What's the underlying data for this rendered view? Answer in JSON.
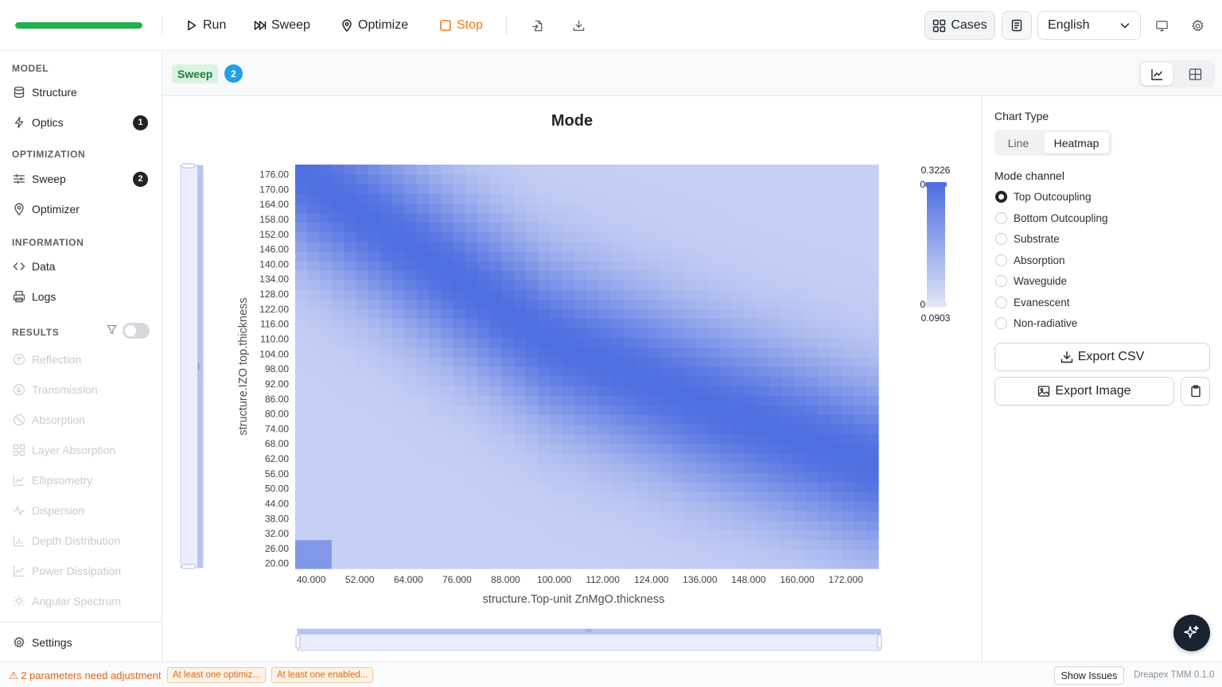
{
  "toolbar": {
    "progress": 1.0,
    "run_label": "Run",
    "sweep_label": "Sweep",
    "optimize_label": "Optimize",
    "stop_label": "Stop",
    "cases_label": "Cases",
    "language": "English"
  },
  "sidebar": {
    "model_title": "MODEL",
    "model_items": [
      {
        "label": "Structure",
        "icon": "database-icon"
      },
      {
        "label": "Optics",
        "icon": "lightning-icon",
        "badge": "1"
      }
    ],
    "optimization_title": "OPTIMIZATION",
    "optimization_items": [
      {
        "label": "Sweep",
        "icon": "sliders-icon",
        "badge": "2"
      },
      {
        "label": "Optimizer",
        "icon": "location-pin-icon"
      }
    ],
    "information_title": "INFORMATION",
    "information_items": [
      {
        "label": "Data",
        "icon": "code-icon"
      },
      {
        "label": "Logs",
        "icon": "printer-icon"
      }
    ],
    "results_title": "RESULTS",
    "results_items": [
      {
        "label": "Reflection"
      },
      {
        "label": "Transmission"
      },
      {
        "label": "Absorption"
      },
      {
        "label": "Layer Absorption"
      },
      {
        "label": "Ellipsometry"
      },
      {
        "label": "Dispersion"
      },
      {
        "label": "Depth Distribution"
      },
      {
        "label": "Power Dissipation"
      },
      {
        "label": "Angular Spectrum"
      }
    ],
    "settings_label": "Settings"
  },
  "subbar": {
    "tag": "Sweep",
    "count": "2"
  },
  "right_panel": {
    "chart_type_label": "Chart Type",
    "chart_types": [
      "Line",
      "Heatmap"
    ],
    "selected_chart_type": "Heatmap",
    "mode_channel_label": "Mode channel",
    "channels": [
      "Top Outcoupling",
      "Bottom Outcoupling",
      "Substrate",
      "Absorption",
      "Waveguide",
      "Evanescent",
      "Non-radiative"
    ],
    "selected_channel": "Top Outcoupling",
    "export_csv_label": "Export CSV",
    "export_image_label": "Export Image"
  },
  "status": {
    "warning": "2 parameters need adjustment",
    "chip1": "At least one optimiz...",
    "chip2": "At least one enabled...",
    "show_issues": "Show Issues",
    "version": "Dreapex TMM 0.1.0"
  },
  "chart_data": {
    "type": "heatmap",
    "title": "Mode",
    "xlabel": "structure.Top-unit ZnMgO.thickness",
    "ylabel": "structure.IZO top.thickness",
    "x_ticks": [
      "40.000",
      "52.000",
      "64.000",
      "76.000",
      "88.000",
      "100.000",
      "112.000",
      "124.000",
      "136.000",
      "148.000",
      "160.000",
      "172.000"
    ],
    "y_ticks": [
      "20.00",
      "26.00",
      "32.00",
      "38.00",
      "44.00",
      "50.00",
      "56.00",
      "62.00",
      "68.00",
      "74.00",
      "80.00",
      "86.00",
      "92.00",
      "98.00",
      "104.00",
      "110.00",
      "116.00",
      "122.00",
      "128.00",
      "134.00",
      "140.00",
      "146.00",
      "152.00",
      "158.00",
      "164.00",
      "170.00",
      "176.00"
    ],
    "x_range": [
      38,
      182
    ],
    "y_range": [
      18,
      180
    ],
    "value_range": [
      0.0903,
      0.3226
    ],
    "colorbar_max_label": "0.3226",
    "colorbar_min_label": "0.0903",
    "colorbar_top_handle": "0",
    "colorbar_bottom_handle": "0",
    "color_low": "#dfe3f8",
    "color_high": "#4f6fe0",
    "ridge_note_x": [
      40,
      100,
      136,
      180
    ],
    "ridge_note_y": [
      176,
      110,
      86,
      60
    ]
  }
}
